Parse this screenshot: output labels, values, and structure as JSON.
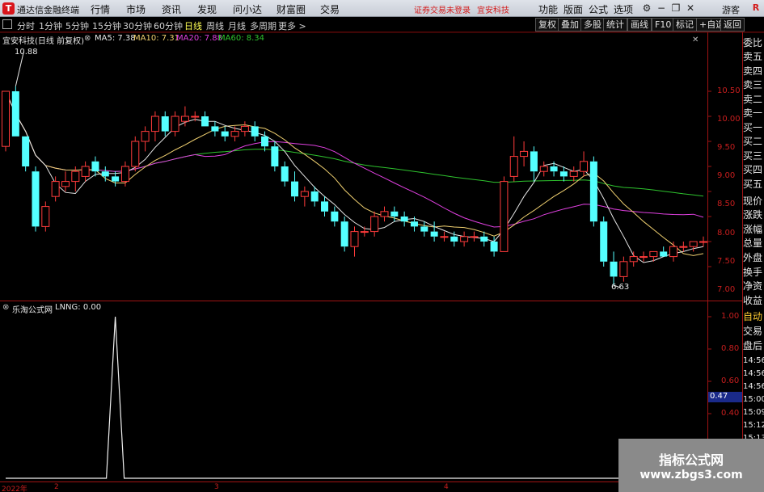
{
  "app": {
    "logo": "T",
    "name": "通达信金融终端"
  },
  "menu": [
    "行情",
    "市场",
    "资讯",
    "发现",
    "问小达",
    "财富圈",
    "交易"
  ],
  "notice": {
    "login": "证券交易未登录",
    "stock": "宜安科技"
  },
  "top_right": {
    "buttons": [
      "功能",
      "版面",
      "公式",
      "选项"
    ],
    "guest": "游客",
    "r": "R"
  },
  "period_bar": {
    "periods": [
      "分时",
      "1分钟",
      "5分钟",
      "15分钟",
      "30分钟",
      "60分钟",
      "日线",
      "周线",
      "月线",
      "多周期",
      "更多 >"
    ],
    "active": "日线",
    "right_buttons": [
      "复权",
      "叠加",
      "多股",
      "统计",
      "画线",
      "F10",
      "标记",
      "+自选",
      "返回"
    ]
  },
  "main_chart": {
    "title": "宜安科技(日线 前复权)",
    "ma": [
      {
        "label": "MA5: 7.38",
        "color": "#e6e6e6"
      },
      {
        "label": "MA10: 7.31",
        "color": "#f0d070"
      },
      {
        "label": "MA20: 7.88",
        "color": "#e040e0"
      },
      {
        "label": "MA60: 8.34",
        "color": "#2ec32e"
      }
    ],
    "high_marker": "10.88",
    "low_marker": "6.63",
    "price_axis": [
      "10.50",
      "10.00",
      "9.50",
      "9.00",
      "8.50",
      "8.00",
      "7.50",
      "7.00"
    ]
  },
  "indicator": {
    "title": "乐淘公式网",
    "value": "LNNG: 0.00",
    "axis": [
      "1.00",
      "0.80",
      "0.60",
      "0.40"
    ],
    "current": "0.47"
  },
  "side_panel": {
    "quote_labels": [
      "委比",
      "卖五",
      "卖四",
      "卖三",
      "卖二",
      "卖一",
      "买一",
      "买二",
      "买三",
      "买四",
      "买五",
      "现价",
      "涨跌",
      "涨幅",
      "总量",
      "外盘",
      "换手",
      "净资",
      "收益"
    ],
    "lower_labels": [
      "自动",
      "交易",
      "盘后"
    ],
    "times": [
      "14:56",
      "14:56",
      "14:56",
      "15:00",
      "15:09",
      "15:12",
      "15:13"
    ]
  },
  "date_axis": [
    "2022年",
    "2",
    "3",
    "4"
  ],
  "watermark": {
    "line1": "指标公式网",
    "line2": "www.zbgs3.com"
  },
  "chart_data": {
    "type": "candlestick",
    "title": "宜安科技(日线 前复权)",
    "y_range": [
      6.5,
      11.0
    ],
    "candles": [
      [
        9.4,
        10.5,
        9.3,
        10.5
      ],
      [
        10.5,
        10.6,
        9.6,
        9.6
      ],
      [
        9.6,
        9.6,
        8.9,
        9.0
      ],
      [
        8.9,
        9.0,
        7.7,
        7.8
      ],
      [
        7.8,
        8.3,
        7.7,
        8.2
      ],
      [
        8.4,
        8.8,
        8.3,
        8.7
      ],
      [
        8.6,
        8.9,
        8.5,
        8.7
      ],
      [
        8.7,
        9.0,
        8.5,
        8.9
      ],
      [
        8.8,
        9.1,
        8.7,
        9.0
      ],
      [
        9.1,
        9.2,
        8.8,
        8.9
      ],
      [
        8.9,
        9.0,
        8.7,
        8.8
      ],
      [
        8.8,
        8.9,
        8.6,
        8.7
      ],
      [
        8.7,
        9.1,
        8.6,
        9.0
      ],
      [
        9.0,
        9.6,
        8.9,
        9.5
      ],
      [
        9.5,
        9.8,
        9.3,
        9.7
      ],
      [
        9.7,
        10.1,
        9.5,
        10.0
      ],
      [
        10.0,
        10.1,
        9.6,
        9.7
      ],
      [
        9.7,
        10.1,
        9.6,
        10.0
      ],
      [
        9.9,
        10.2,
        9.8,
        10.0
      ],
      [
        10.0,
        10.1,
        9.9,
        10.0
      ],
      [
        10.0,
        10.1,
        9.8,
        9.8
      ],
      [
        9.8,
        9.9,
        9.6,
        9.7
      ],
      [
        9.7,
        9.8,
        9.5,
        9.6
      ],
      [
        9.6,
        9.8,
        9.5,
        9.7
      ],
      [
        9.7,
        9.9,
        9.6,
        9.8
      ],
      [
        9.8,
        9.9,
        9.5,
        9.6
      ],
      [
        9.6,
        9.7,
        9.3,
        9.4
      ],
      [
        9.4,
        9.5,
        8.9,
        9.0
      ],
      [
        9.0,
        9.1,
        8.6,
        8.7
      ],
      [
        8.7,
        8.9,
        8.3,
        8.4
      ],
      [
        8.4,
        8.6,
        8.2,
        8.5
      ],
      [
        8.5,
        8.6,
        8.2,
        8.3
      ],
      [
        8.3,
        8.4,
        8.0,
        8.1
      ],
      [
        8.1,
        8.2,
        7.8,
        7.9
      ],
      [
        7.9,
        8.0,
        7.3,
        7.4
      ],
      [
        7.4,
        7.8,
        7.2,
        7.7
      ],
      [
        7.7,
        7.8,
        7.6,
        7.7
      ],
      [
        7.7,
        8.1,
        7.6,
        8.0
      ],
      [
        8.0,
        8.2,
        7.9,
        8.1
      ],
      [
        8.1,
        8.2,
        7.9,
        8.0
      ],
      [
        8.0,
        8.1,
        7.8,
        7.9
      ],
      [
        7.9,
        8.0,
        7.7,
        7.8
      ],
      [
        7.8,
        7.9,
        7.6,
        7.7
      ],
      [
        7.7,
        7.9,
        7.5,
        7.6
      ],
      [
        7.6,
        7.7,
        7.5,
        7.6
      ],
      [
        7.6,
        7.7,
        7.4,
        7.5
      ],
      [
        7.5,
        7.7,
        7.4,
        7.6
      ],
      [
        7.6,
        7.7,
        7.5,
        7.6
      ],
      [
        7.6,
        7.7,
        7.4,
        7.5
      ],
      [
        7.5,
        7.6,
        7.2,
        7.3
      ],
      [
        7.3,
        8.8,
        7.3,
        8.7
      ],
      [
        8.8,
        9.6,
        8.7,
        9.2
      ],
      [
        9.2,
        9.5,
        9.0,
        9.3
      ],
      [
        9.3,
        9.4,
        8.7,
        8.9
      ],
      [
        8.9,
        9.1,
        8.8,
        9.0
      ],
      [
        9.0,
        9.1,
        8.8,
        8.9
      ],
      [
        8.9,
        9.0,
        8.7,
        8.8
      ],
      [
        8.8,
        9.0,
        8.7,
        8.9
      ],
      [
        8.9,
        9.3,
        8.8,
        9.1
      ],
      [
        9.1,
        9.2,
        7.8,
        7.9
      ],
      [
        7.9,
        8.0,
        7.0,
        7.1
      ],
      [
        7.1,
        7.3,
        6.63,
        6.8
      ],
      [
        6.8,
        7.2,
        6.7,
        7.1
      ],
      [
        7.1,
        7.3,
        7.0,
        7.2
      ],
      [
        7.2,
        7.3,
        7.1,
        7.2
      ],
      [
        7.2,
        7.3,
        7.1,
        7.3
      ],
      [
        7.3,
        7.4,
        7.2,
        7.2
      ],
      [
        7.2,
        7.5,
        7.1,
        7.4
      ],
      [
        7.4,
        7.5,
        7.3,
        7.4
      ],
      [
        7.4,
        7.5,
        7.3,
        7.5
      ],
      [
        7.5,
        7.6,
        7.4,
        7.5
      ]
    ],
    "candle_fields": [
      "open",
      "high",
      "low",
      "close"
    ],
    "lnng_spike_index": 11,
    "lnng_range": [
      0,
      1
    ]
  }
}
